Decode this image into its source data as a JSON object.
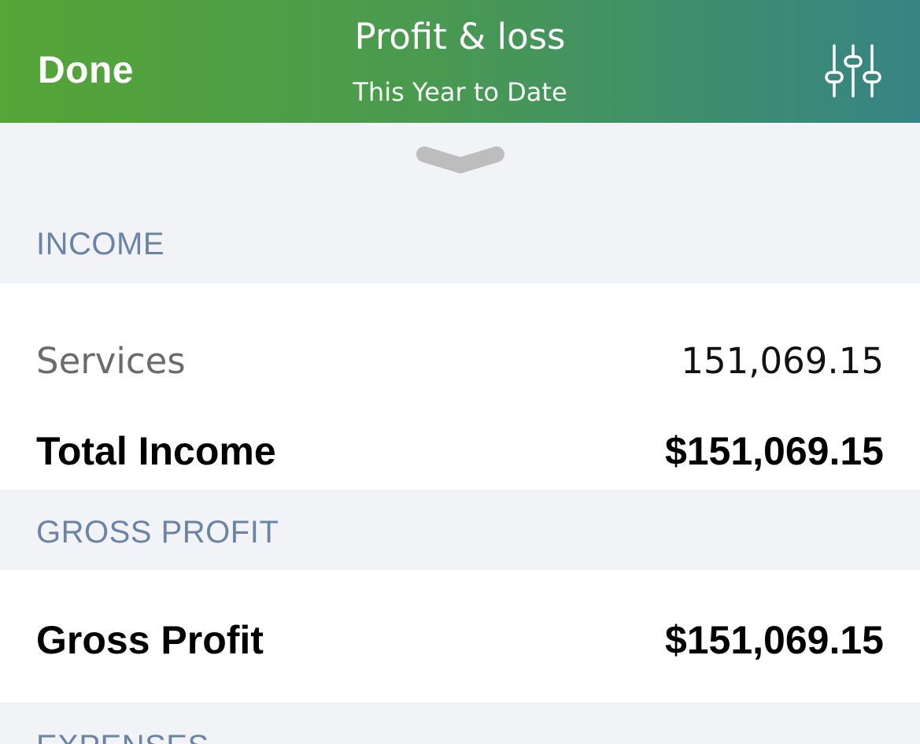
{
  "header": {
    "done_label": "Done",
    "title": "Profit & loss",
    "subtitle": "This Year to Date",
    "settings_icon": "sliders-icon",
    "gradient_start": "#55a537",
    "gradient_end": "#378485"
  },
  "handle": {
    "icon": "chevron-down-icon"
  },
  "sections": {
    "income": {
      "label": "INCOME",
      "rows": [
        {
          "name": "Services",
          "value": "151,069.15"
        }
      ],
      "total": {
        "name": "Total Income",
        "value": "$151,069.15"
      }
    },
    "gross_profit": {
      "label": "GROSS PROFIT",
      "total": {
        "name": "Gross Profit",
        "value": "$151,069.15"
      }
    },
    "expenses": {
      "label": "EXPENSES"
    }
  },
  "colors": {
    "section_label": "#6a84a6",
    "background": "#f2f3f7",
    "row_background": "#ffffff"
  }
}
